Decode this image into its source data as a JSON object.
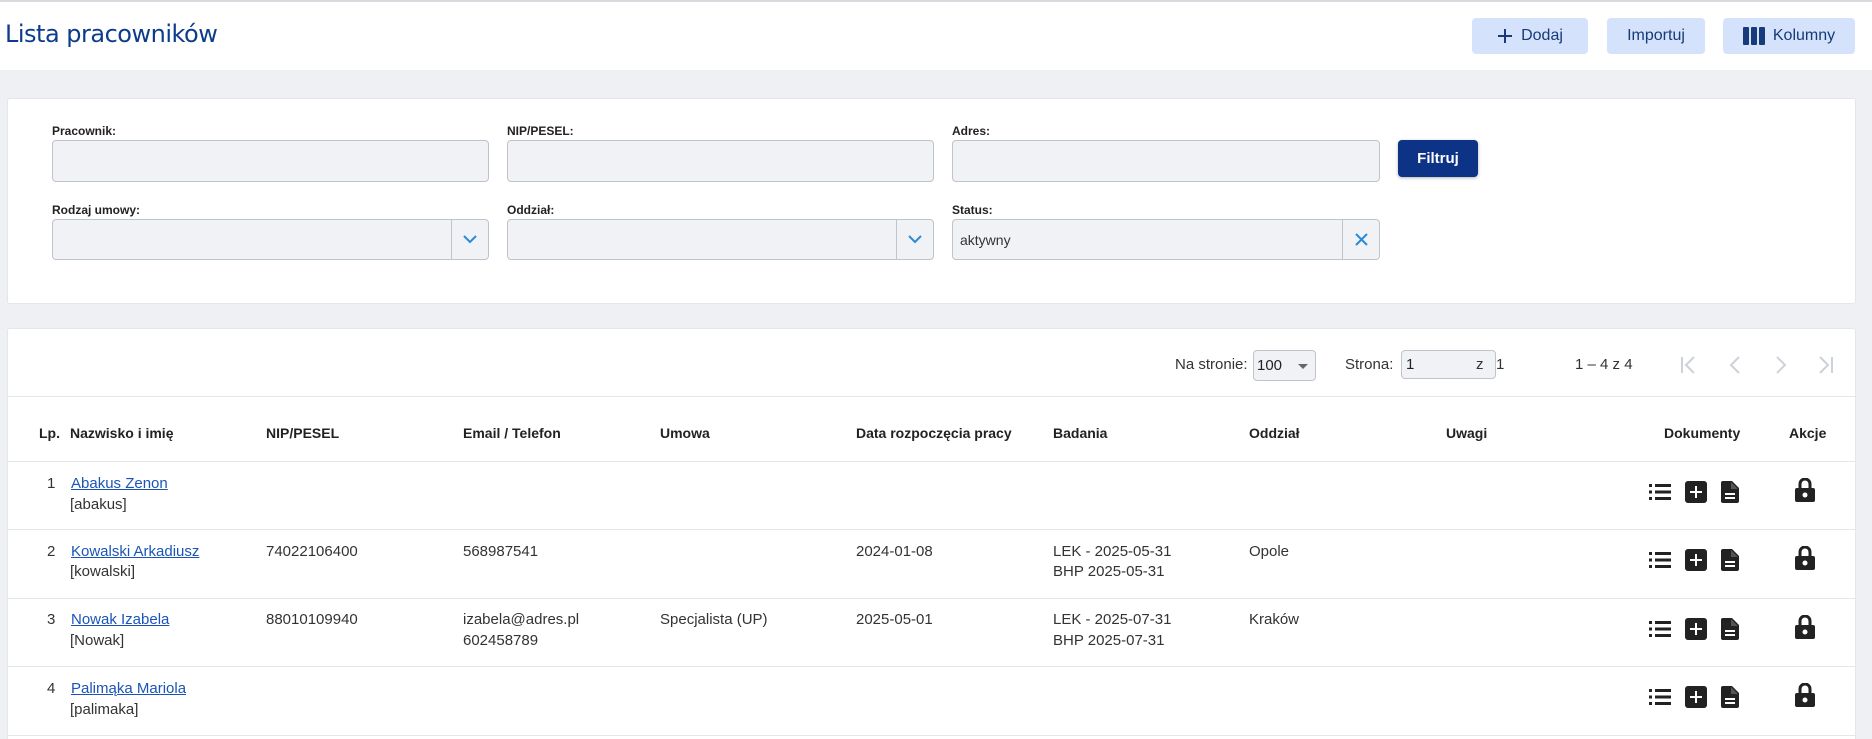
{
  "header": {
    "title": "Lista pracowników",
    "add_label": "Dodaj",
    "import_label": "Importuj",
    "columns_label": "Kolumny"
  },
  "filters": {
    "employee_label": "Pracownik:",
    "employee_value": "",
    "nip_label": "NIP/PESEL:",
    "nip_value": "",
    "address_label": "Adres:",
    "address_value": "",
    "contract_label": "Rodzaj umowy:",
    "contract_value": "",
    "branch_label": "Oddział:",
    "branch_value": "",
    "status_label": "Status:",
    "status_value": "aktywny",
    "filter_button": "Filtruj"
  },
  "pagination": {
    "per_page_label": "Na stronie:",
    "per_page_value": "100",
    "page_label": "Strona:",
    "page_value": "1",
    "of_label": "z",
    "total_pages": "1",
    "range": "1 – 4 z 4"
  },
  "table": {
    "columns": [
      "Lp.",
      "Nazwisko i imię",
      "NIP/PESEL",
      "Email / Telefon",
      "Umowa",
      "Data rozpoczęcia pracy",
      "Badania",
      "Oddział",
      "Uwagi",
      "Dokumenty",
      "Akcje"
    ],
    "rows": [
      {
        "lp": "1",
        "name": "Abakus Zenon",
        "login": "[abakus]",
        "nip": "",
        "email": "",
        "phone": "",
        "contract": "",
        "start": "",
        "exam1": "",
        "exam2": "",
        "branch": "",
        "notes": ""
      },
      {
        "lp": "2",
        "name": "Kowalski Arkadiusz",
        "login": "[kowalski]",
        "nip": "74022106400",
        "email": "568987541",
        "phone": "",
        "contract": "",
        "start": "2024-01-08",
        "exam1": "LEK - 2025-05-31",
        "exam2": "BHP 2025-05-31",
        "branch": "Opole",
        "notes": ""
      },
      {
        "lp": "3",
        "name": "Nowak Izabela",
        "login": "[Nowak]",
        "nip": "88010109940",
        "email": "izabela@adres.pl",
        "phone": "602458789",
        "contract": "Specjalista (UP)",
        "start": "2025-05-01",
        "exam1": "LEK - 2025-07-31",
        "exam2": "BHP 2025-07-31",
        "branch": "Kraków",
        "notes": ""
      },
      {
        "lp": "4",
        "name": "Palimąka Mariola",
        "login": "[palimaka]",
        "nip": "",
        "email": "",
        "phone": "",
        "contract": "",
        "start": "",
        "exam1": "",
        "exam2": "",
        "branch": "",
        "notes": ""
      }
    ]
  },
  "icons": {
    "add": "plus-icon",
    "columns": "columns-icon",
    "dropdown": "chevron-down-icon",
    "clear": "close-icon",
    "doc_list": "list-icon",
    "doc_add": "add-box-icon",
    "doc_file": "file-icon",
    "action_lock": "lock-icon",
    "nav": [
      "first-page-icon",
      "prev-page-icon",
      "next-page-icon",
      "last-page-icon"
    ]
  },
  "colors": {
    "primary": "#0c3386",
    "title": "#0e3c8c",
    "button_bg": "#d4e3fb",
    "link": "#1a54b8",
    "accent": "#2a8ad8"
  }
}
